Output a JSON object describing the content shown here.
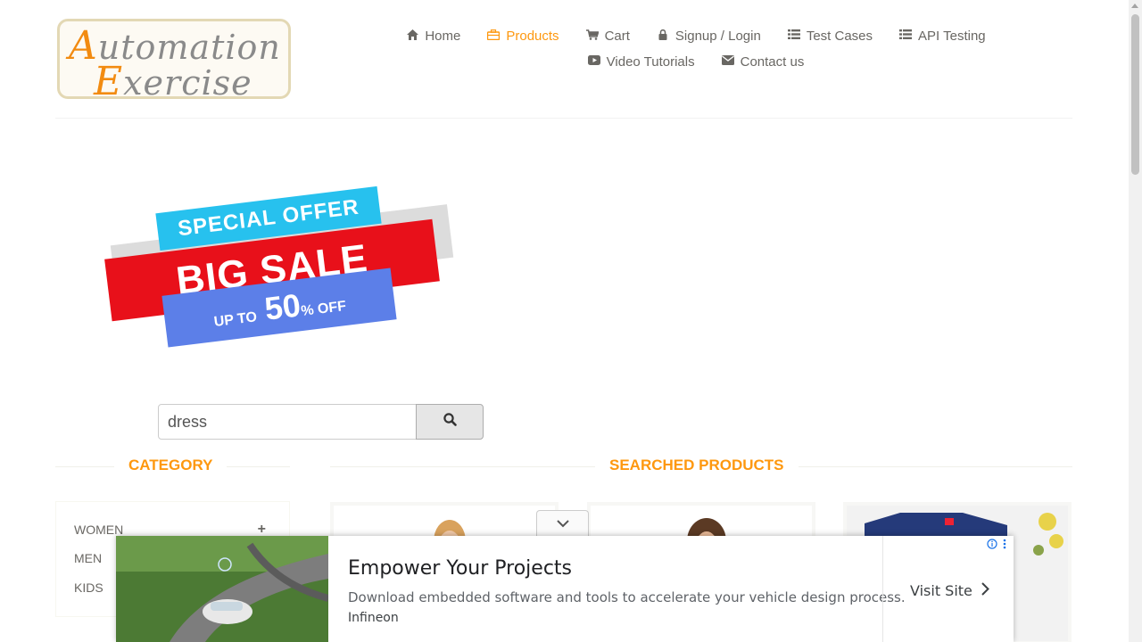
{
  "logo": {
    "line1_cap": "A",
    "line1_rest": "utomation",
    "line2_cap": "E",
    "line2_rest": "xercise"
  },
  "nav": {
    "row1": [
      {
        "icon": "home-icon",
        "label": "Home",
        "active": false
      },
      {
        "icon": "briefcase-icon",
        "label": "Products",
        "active": true
      },
      {
        "icon": "cart-icon",
        "label": "Cart",
        "active": false
      },
      {
        "icon": "lock-icon",
        "label": "Signup / Login",
        "active": false
      },
      {
        "icon": "list-icon",
        "label": "Test Cases",
        "active": false
      },
      {
        "icon": "list-icon",
        "label": "API Testing",
        "active": false
      }
    ],
    "row2": [
      {
        "icon": "youtube-play-icon",
        "label": "Video Tutorials",
        "active": false
      },
      {
        "icon": "envelope-icon",
        "label": "Contact us",
        "active": false
      }
    ]
  },
  "banner": {
    "top": "SPECIAL OFFER",
    "middle": "BIG SALE",
    "bottom_prefix": "UP TO",
    "bottom_value": "50",
    "bottom_suffix": "% OFF"
  },
  "search": {
    "value": "dress",
    "button_icon": "search-icon"
  },
  "category": {
    "title": "Category",
    "items": [
      "WOMEN",
      "MEN",
      "KIDS"
    ],
    "expand_symbol": "+"
  },
  "products": {
    "title": "Searched Products"
  },
  "ad": {
    "title": "Empower Your Projects",
    "description": "Download embedded software and tools to accelerate your vehicle design process.",
    "brand": "Infineon",
    "cta": "Visit Site"
  },
  "colors": {
    "accent": "#fe980f",
    "text": "#696763"
  }
}
